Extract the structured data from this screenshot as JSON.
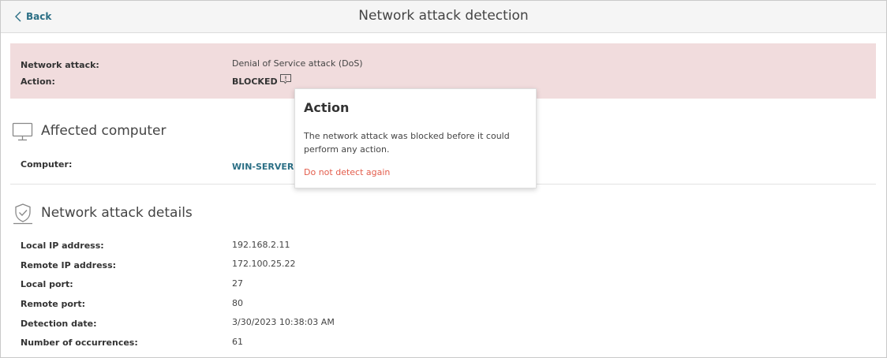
{
  "header": {
    "back_label": "Back",
    "title": "Network attack detection"
  },
  "alert": {
    "attack_label": "Network attack:",
    "attack_value": "Denial of Service attack (DoS)",
    "action_label": "Action:",
    "action_value": "BLOCKED",
    "background_color": "#f1dcdd"
  },
  "affected": {
    "title": "Affected computer",
    "icon": "monitor-icon",
    "computer_label": "Computer:",
    "computer_value": "WIN-SERVER-2"
  },
  "details": {
    "title": "Network attack details",
    "icon": "shield-check-icon",
    "rows": [
      {
        "label": "Local IP address:",
        "value": "192.168.2.11"
      },
      {
        "label": "Remote IP address:",
        "value": "172.100.25.22"
      },
      {
        "label": "Local port:",
        "value": "27"
      },
      {
        "label": "Remote port:",
        "value": "80"
      },
      {
        "label": "Detection date:",
        "value": "3/30/2023 10:38:03 AM"
      },
      {
        "label": "Number of occurrences:",
        "value": "61"
      }
    ]
  },
  "popover": {
    "title": "Action",
    "text": "The network attack was blocked before it could perform any action.",
    "link": "Do not detect again",
    "link_color": "#e35d4c"
  },
  "colors": {
    "link": "#2b6f85",
    "text": "#333333"
  }
}
